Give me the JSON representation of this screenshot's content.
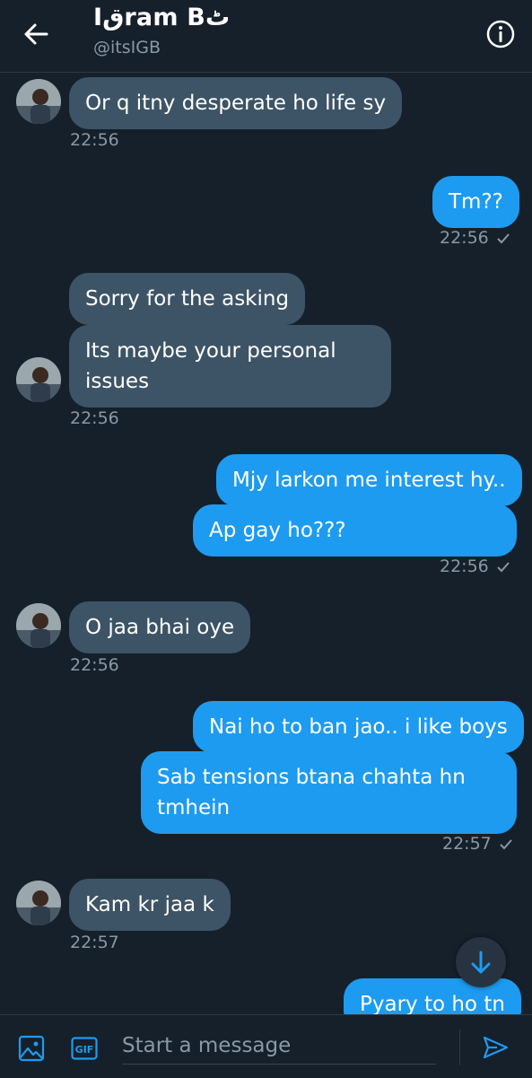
{
  "header": {
    "name": "Iقram Bٹ",
    "handle": "@itsIGB"
  },
  "messages": [
    {
      "side": "in",
      "text": "Or q itny desperate ho life sy",
      "time": "22:56"
    },
    {
      "side": "out",
      "text": "Tm??",
      "time": "22:56"
    },
    {
      "side": "in",
      "text": "Sorry for the asking"
    },
    {
      "side": "in",
      "text": "Its maybe your personal issues",
      "time": "22:56"
    },
    {
      "side": "out",
      "text": "Mjy larkon me interest hy.."
    },
    {
      "side": "out",
      "text": "Ap gay ho???",
      "time": "22:56"
    },
    {
      "side": "in",
      "text": "O jaa bhai oye",
      "time": "22:56"
    },
    {
      "side": "out",
      "text": "Nai ho to ban jao.. i like boys"
    },
    {
      "side": "out",
      "text": "Sab tensions btana chahta hn tmhein",
      "time": "22:57"
    },
    {
      "side": "in",
      "text": "Kam kr jaa k",
      "time": "22:57"
    },
    {
      "side": "out",
      "text": "Pyary to ho tn"
    }
  ],
  "composer": {
    "placeholder": "Start a message",
    "gif_label": "GIF"
  },
  "colors": {
    "background": "#15202b",
    "incoming_bubble": "#3d5466",
    "outgoing_bubble": "#1d9bf0",
    "muted_text": "#8899a6"
  }
}
